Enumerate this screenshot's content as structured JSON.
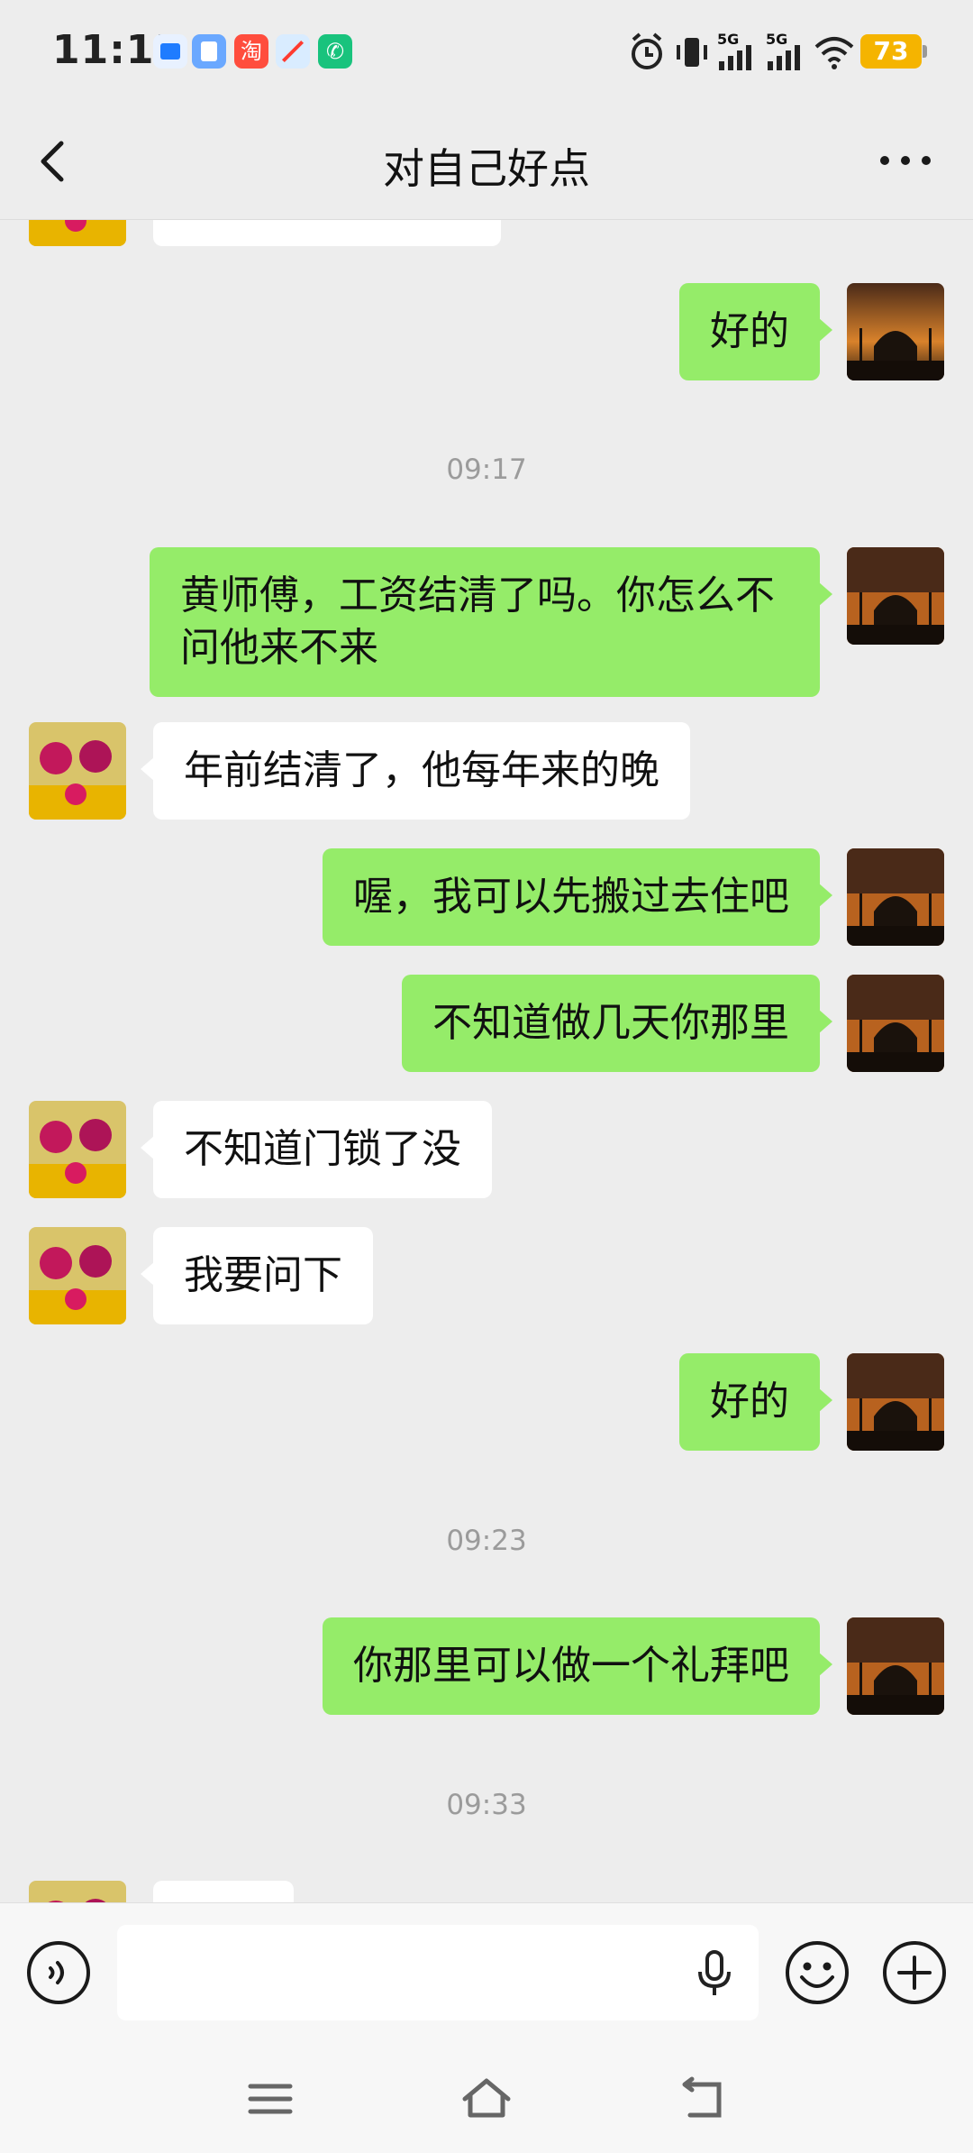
{
  "status_bar": {
    "time": "11:15",
    "app_icons": [
      "blue-app-icon",
      "file-app-icon",
      "taobao-icon",
      "safari-icon",
      "phone-icon"
    ],
    "network_1": "5G",
    "network_2": "5G",
    "battery": "73"
  },
  "header": {
    "title": "对自己好点"
  },
  "messages": [
    {
      "type": "in",
      "text": ""
    },
    {
      "type": "out",
      "text": "好的"
    },
    {
      "type": "time",
      "text": "09:17"
    },
    {
      "type": "out",
      "text": "黄师傅，工资结清了吗。你怎么不问他来不来"
    },
    {
      "type": "in",
      "text": "年前结清了，他每年来的晚"
    },
    {
      "type": "out",
      "text": "喔，我可以先搬过去住吧"
    },
    {
      "type": "out",
      "text": "不知道做几天你那里"
    },
    {
      "type": "in",
      "text": "不知道门锁了没"
    },
    {
      "type": "in",
      "text": "我要问下"
    },
    {
      "type": "out",
      "text": "好的"
    },
    {
      "type": "time",
      "text": "09:23"
    },
    {
      "type": "out",
      "text": "你那里可以做一个礼拜吧"
    },
    {
      "type": "time",
      "text": "09:33"
    },
    {
      "type": "in",
      "text": ""
    }
  ],
  "input": {
    "value": "",
    "placeholder": ""
  },
  "colors": {
    "background": "#ededed",
    "outgoing_bubble": "#95ec69",
    "incoming_bubble": "#ffffff",
    "battery": "#f5b400"
  }
}
